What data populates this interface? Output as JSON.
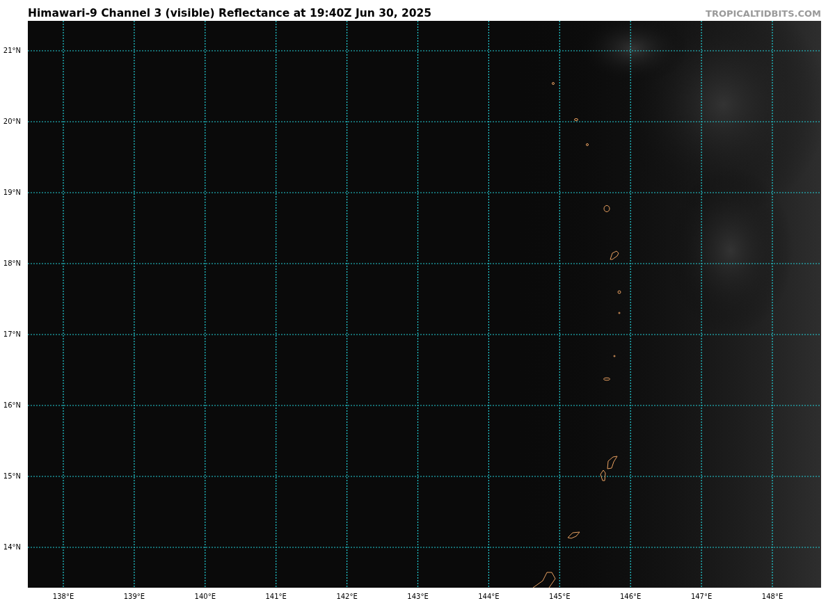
{
  "header": {
    "title": "Himawari-9 Channel 3 (visible) Reflectance at 19:40Z Jun 30, 2025",
    "credit": "TROPICALTIDBITS.COM"
  },
  "map": {
    "latitude_labels": [
      "21°N",
      "20°N",
      "19°N",
      "18°N",
      "17°N",
      "16°N",
      "15°N",
      "14°N"
    ],
    "longitude_labels": [
      "138°E",
      "139°E",
      "140°E",
      "141°E",
      "142°E",
      "143°E",
      "144°E",
      "145°E",
      "146°E",
      "147°E",
      "148°E"
    ]
  }
}
